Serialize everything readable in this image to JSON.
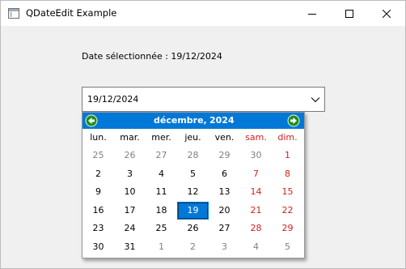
{
  "window": {
    "title": "QDateEdit Example"
  },
  "label": {
    "text": "Date sélectionnée : 19/12/2024"
  },
  "dateedit": {
    "value": "19/12/2024"
  },
  "calendar": {
    "month": "décembre,",
    "year": "2024",
    "weekdays": [
      "lun.",
      "mar.",
      "mer.",
      "jeu.",
      "ven.",
      "sam.",
      "dim."
    ],
    "weeks": [
      [
        "25",
        "26",
        "27",
        "28",
        "29",
        "30",
        "1"
      ],
      [
        "2",
        "3",
        "4",
        "5",
        "6",
        "7",
        "8"
      ],
      [
        "9",
        "10",
        "11",
        "12",
        "13",
        "14",
        "15"
      ],
      [
        "16",
        "17",
        "18",
        "19",
        "20",
        "21",
        "22"
      ],
      [
        "23",
        "24",
        "25",
        "26",
        "27",
        "28",
        "29"
      ],
      [
        "30",
        "31",
        "1",
        "2",
        "3",
        "4",
        "5"
      ]
    ],
    "selected": "19"
  },
  "colors": {
    "accent": "#0078d7",
    "weekend": "#d42020",
    "other_month": "#808080",
    "nav_arrow": "#1e8e1e"
  },
  "icons": {
    "app": "window-app-icon",
    "minimize": "minimize-icon",
    "maximize": "maximize-icon",
    "close": "close-icon",
    "dropdown": "chevron-down-icon",
    "prev": "arrow-left-icon",
    "next": "arrow-right-icon"
  }
}
